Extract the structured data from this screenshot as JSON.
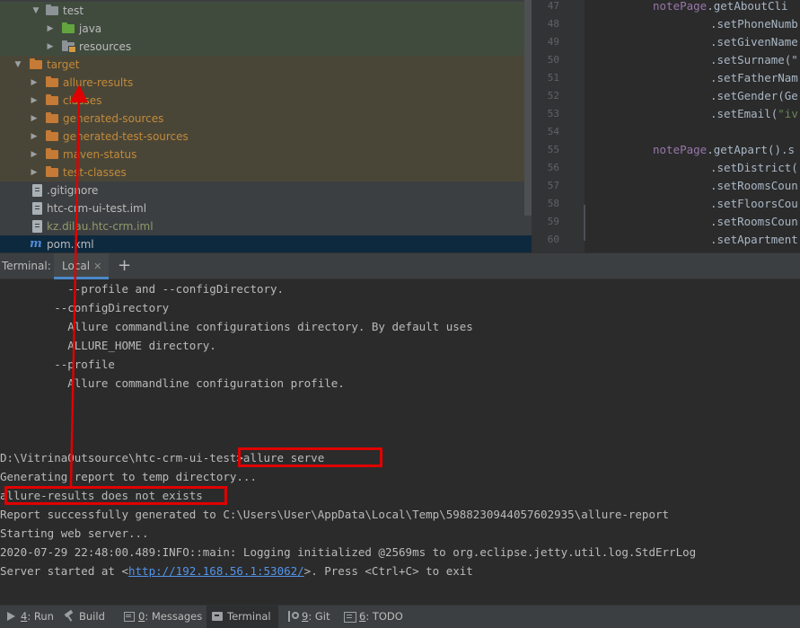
{
  "project_tree": {
    "items": [
      {
        "label": "test",
        "icon": "folder-gray-icon",
        "expanded": true
      },
      {
        "label": "java",
        "icon": "folder-green-icon",
        "expanded": false
      },
      {
        "label": "resources",
        "icon": "resources-folder-icon",
        "expanded": false
      },
      {
        "label": "target",
        "icon": "folder-orange-icon",
        "expanded": true
      },
      {
        "label": "allure-results",
        "icon": "folder-orange-icon",
        "expanded": false
      },
      {
        "label": "classes",
        "icon": "folder-orange-icon",
        "expanded": false
      },
      {
        "label": "generated-sources",
        "icon": "folder-orange-icon",
        "expanded": false
      },
      {
        "label": "generated-test-sources",
        "icon": "folder-orange-icon",
        "expanded": false
      },
      {
        "label": "maven-status",
        "icon": "folder-orange-icon",
        "expanded": false
      },
      {
        "label": "test-classes",
        "icon": "folder-orange-icon",
        "expanded": false
      },
      {
        "label": ".gitignore",
        "icon": "file-icon"
      },
      {
        "label": "htc-crm-ui-test.iml",
        "icon": "file-icon"
      },
      {
        "label": "kz.dilau.htc-crm.iml",
        "icon": "file-icon"
      },
      {
        "label": "pom.xml",
        "icon": "maven-icon"
      }
    ]
  },
  "editor": {
    "lines": [
      {
        "num": "47",
        "obj": "notePage",
        "rest": ".getAboutCli"
      },
      {
        "num": "48",
        "obj": "",
        "rest": ".setPhoneNumb"
      },
      {
        "num": "49",
        "obj": "",
        "rest": ".setGivenName"
      },
      {
        "num": "50",
        "obj": "",
        "rest": ".setSurname(\""
      },
      {
        "num": "51",
        "obj": "",
        "rest": ".setFatherNam"
      },
      {
        "num": "52",
        "obj": "",
        "rest": ".setGender(Ge"
      },
      {
        "num": "53",
        "obj": "",
        "rest": ".setEmail(",
        "str": "\"iv"
      },
      {
        "num": "54",
        "obj": "",
        "rest": ""
      },
      {
        "num": "55",
        "obj": "notePage",
        "rest": ".getApart().s"
      },
      {
        "num": "56",
        "obj": "",
        "rest": ".setDistrict("
      },
      {
        "num": "57",
        "obj": "",
        "rest": ".setRoomsCoun"
      },
      {
        "num": "58",
        "obj": "",
        "rest": ".setFloorsCou"
      },
      {
        "num": "59",
        "obj": "",
        "rest": ".setRoomsCoun"
      },
      {
        "num": "60",
        "obj": "",
        "rest": ".setApartment"
      }
    ]
  },
  "terminal_tabs": {
    "title": "Terminal:",
    "local_tab": "Local",
    "close_glyph": "✕",
    "add_glyph": "+"
  },
  "terminal": {
    "lines": [
      "          --profile and --configDirectory.",
      "        --configDirectory",
      "          Allure commandline configurations directory. By default uses",
      "          ALLURE_HOME directory.",
      "        --profile",
      "          Allure commandline configuration profile.",
      "",
      "",
      "",
      "D:\\VitrinaOutsource\\htc-crm-ui-test>allure serve",
      "Generating report to temp directory...",
      "allure-results does not exists",
      "Report successfully generated to C:\\Users\\User\\AppData\\Local\\Temp\\5988230944057602935\\allure-report",
      "Starting web server...",
      "2020-07-29 22:48:00.489:INFO::main: Logging initialized @2569ms to org.eclipse.jetty.util.log.StdErrLog"
    ],
    "server_prefix": "Server started at <",
    "server_url": "http://192.168.56.1:53062/",
    "server_suffix": ">. Press <Ctrl+C> to exit"
  },
  "toolbar": {
    "items": [
      {
        "key": "4",
        "label": ": Run",
        "icon": "run-icon"
      },
      {
        "key": "",
        "label": "Build",
        "icon": "hammer-icon"
      },
      {
        "key": "0",
        "label": ": Messages",
        "icon": "messages-icon"
      },
      {
        "key": "",
        "label": "Terminal",
        "icon": "terminal-icon",
        "active": true
      },
      {
        "key": "9",
        "label": ": Git",
        "icon": "git-icon"
      },
      {
        "key": "6",
        "label": ": TODO",
        "icon": "todo-icon"
      }
    ]
  },
  "colors": {
    "annotation_red": "#e00000",
    "link_blue": "#5394ec",
    "excluded_orange": "#c28a3a"
  }
}
